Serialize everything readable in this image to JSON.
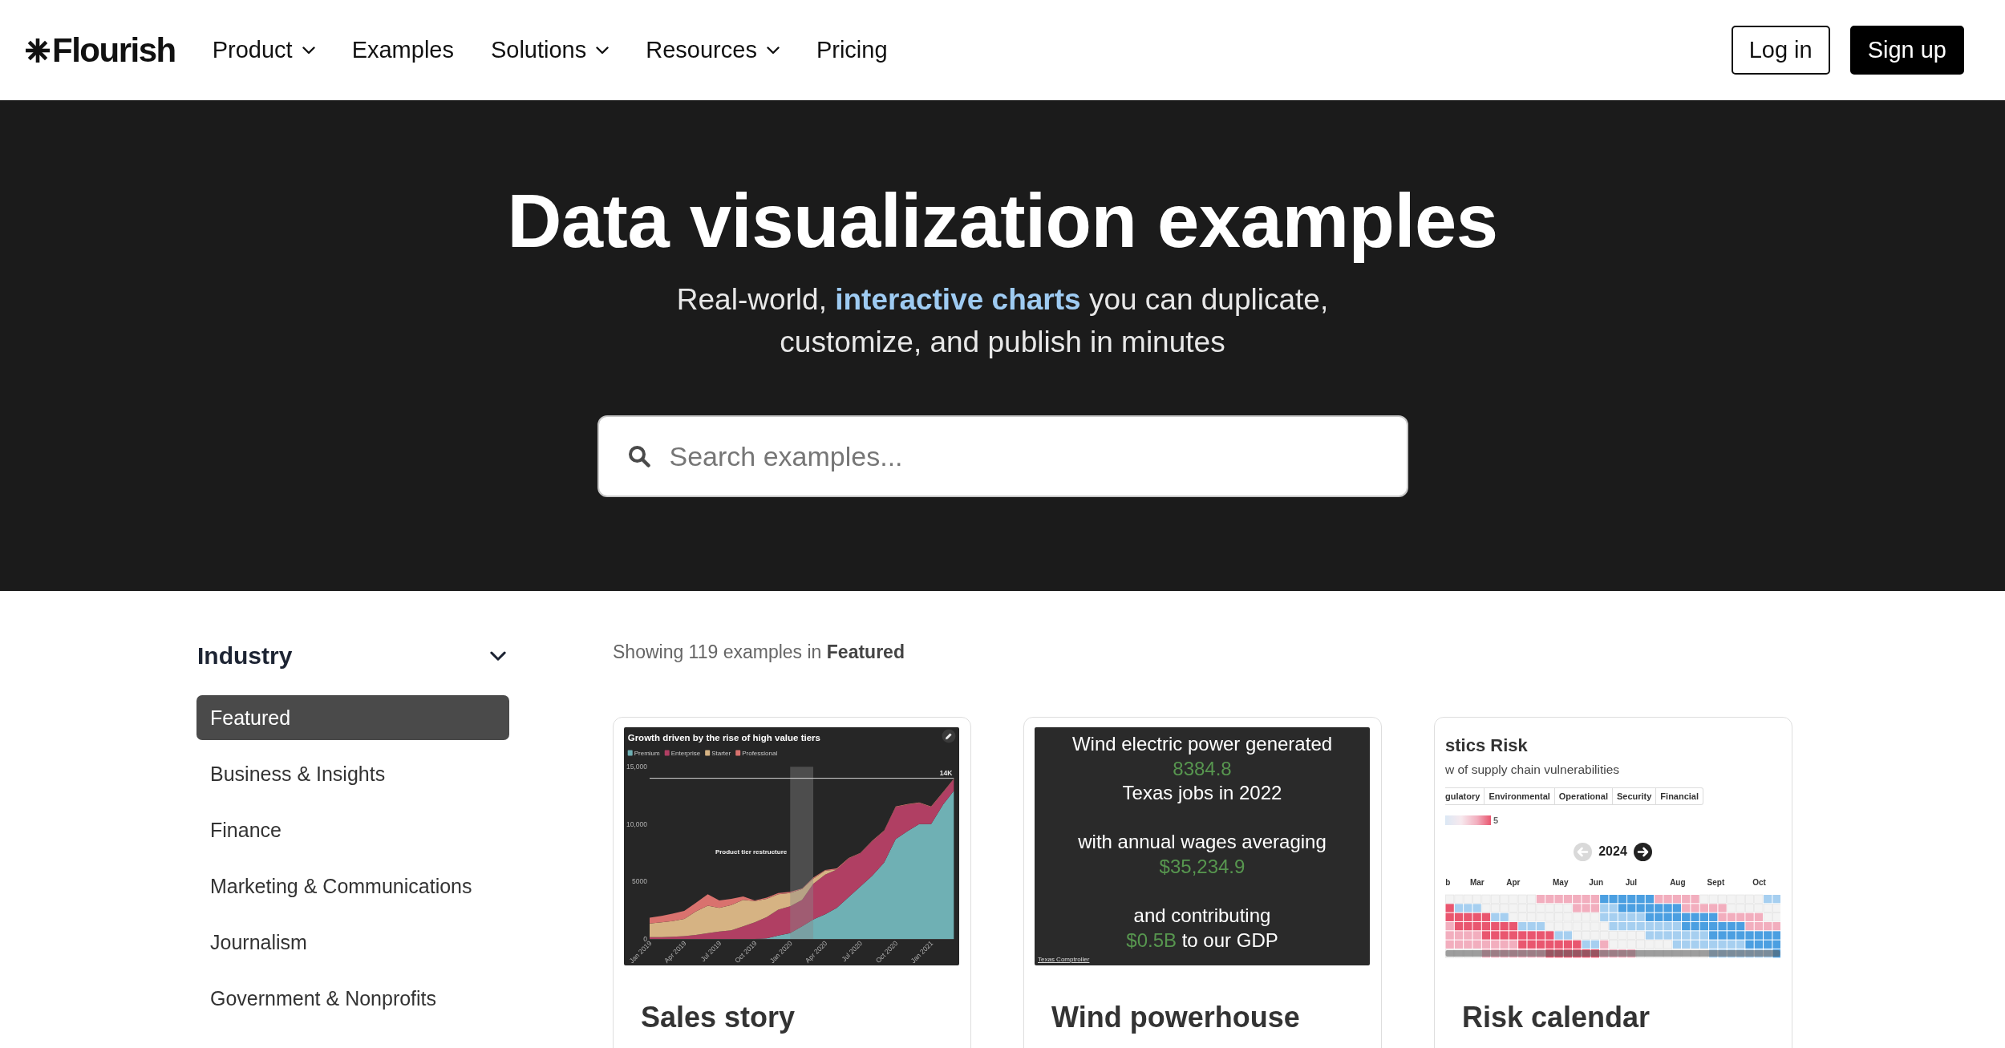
{
  "nav": {
    "logo": {
      "text": "Flourish"
    },
    "items": [
      {
        "label": "Product",
        "has_menu": true
      },
      {
        "label": "Examples",
        "has_menu": false
      },
      {
        "label": "Solutions",
        "has_menu": true
      },
      {
        "label": "Resources",
        "has_menu": true
      },
      {
        "label": "Pricing",
        "has_menu": false
      }
    ],
    "buttons": [
      {
        "label": "Log in",
        "kind": "outline"
      },
      {
        "label": "Sign up",
        "kind": "solid"
      }
    ]
  },
  "hero": {
    "title": "Data visualization examples",
    "subtitle": {
      "before": "Real-world,",
      "link": "interactive charts",
      "after": "you can duplicate, customize, and publish in minutes"
    },
    "search": {
      "placeholder": "Search examples..."
    }
  },
  "sidebar": {
    "groups": [
      {
        "title": "Industry",
        "expanded": true,
        "items": [
          {
            "label": "Featured",
            "selected": true
          },
          {
            "label": "Business & Insights",
            "selected": false
          },
          {
            "label": "Finance",
            "selected": false
          },
          {
            "label": "Marketing & Communications",
            "selected": false
          },
          {
            "label": "Journalism",
            "selected": false
          },
          {
            "label": "Government & Nonprofits",
            "selected": false
          }
        ]
      }
    ]
  },
  "results": {
    "summary": "Showing 119 examples in **Featured**",
    "cards": [
      {
        "kind": "chart",
        "title": "Sales story",
        "preview": {
          "chart_data": {
            "type": "area",
            "title": "Growth driven by the rise of high value tiers",
            "stacked": true,
            "legend": "top",
            "x": [
              "2019-01-01",
              "2019-02-01",
              "2019-03-01",
              "2019-04-01",
              "2019-05-01",
              "2019-06-01",
              "2019-07-01",
              "2019-08-01",
              "2019-09-01",
              "2019-10-01",
              "2019-11-01",
              "2019-12-01",
              "2020-01-01",
              "2020-02-01",
              "2020-03-01",
              "2020-04-01",
              "2020-05-01",
              "2020-06-01",
              "2020-07-01",
              "2020-08-01",
              "2020-09-01",
              "2020-10-01",
              "2020-11-01",
              "2020-12-01",
              "2021-01-01",
              "2021-02-01",
              "2021-03-01"
            ],
            "xlim": [
              "2019-01-01",
              "2021-03-01"
            ],
            "xticks": [
              {
                "value": "2019-01-01",
                "label": "Jan 2019"
              },
              {
                "value": "2019-04-01",
                "label": "Apr 2019"
              },
              {
                "value": "2019-07-01",
                "label": "Jul 2019"
              },
              {
                "value": "2019-10-01",
                "label": "Oct 2019"
              },
              {
                "value": "2020-01-01",
                "label": "Jan 2020"
              },
              {
                "value": "2020-04-01",
                "label": "Apr 2020"
              },
              {
                "value": "2020-07-01",
                "label": "Jul 2020"
              },
              {
                "value": "2020-10-01",
                "label": "Oct 2020"
              },
              {
                "value": "2021-01-01",
                "label": "Jan 2021"
              }
            ],
            "ylim": [
              0,
              15000
            ],
            "yticks": [
              {
                "value": 0,
                "label": "0"
              },
              {
                "value": 5000,
                "label": "5000"
              },
              {
                "value": 10000,
                "label": "10,000"
              },
              {
                "value": 15000,
                "label": "15,000"
              }
            ],
            "series": [
              {
                "name": "Premium",
                "color": "#6fb0b4",
                "values": [
                  0,
                  0,
                  0,
                  0,
                  0,
                  0,
                  0,
                  0,
                  0,
                  0,
                  50,
                  300,
                  500,
                  1100,
                  1700,
                  2150,
                  2700,
                  3650,
                  4550,
                  5500,
                  6650,
                  8700,
                  9400,
                  10000,
                  10000,
                  11700,
                  12900
                ]
              },
              {
                "name": "Enterprise",
                "color": "#b03f63",
                "values": [
                  150,
                  150,
                  200,
                  250,
                  350,
                  500,
                  650,
                  750,
                  1100,
                  1450,
                  1850,
                  2250,
                  2350,
                  2300,
                  3100,
                  3450,
                  3350,
                  3350,
                  2900,
                  3000,
                  2750,
                  2800,
                  2300,
                  1850,
                  1500,
                  1050,
                  1000
                ]
              },
              {
                "name": "Starter",
                "color": "#d6b383",
                "values": [
                  1200,
                  1300,
                  1350,
                  1500,
                  2050,
                  2400,
                  2050,
                  2200,
                  2300,
                  1850,
                  1600,
                  1350,
                  1150,
                  950,
                  450,
                  350,
                  0,
                  0,
                  0,
                  0,
                  0,
                  0,
                  0,
                  0,
                  0,
                  0,
                  0
                ]
              },
              {
                "name": "Professional",
                "color": "#d9726e",
                "values": [
                  500,
                  550,
                  650,
                  700,
                  750,
                  1000,
                  650,
                  550,
                  300,
                  50,
                  100,
                  100,
                  100,
                  50,
                  100,
                  50,
                  100,
                  50,
                  50,
                  50,
                  50,
                  50,
                  50,
                  50,
                  50,
                  50,
                  50
                ]
              }
            ],
            "ref_lines": [
              {
                "axis": "y",
                "value": 14000,
                "label": "14K",
                "color": "#d8d8d8"
              }
            ],
            "bands": [
              {
                "axis": "x",
                "from": "2020-01-01",
                "to": "2020-03-01",
                "label": "Product tier restructure",
                "color": "#8a8a8a"
              }
            ]
          }
        }
      },
      {
        "kind": "stats",
        "title": "Wind powerhouse",
        "preview": {
          "blocks": [
            {
              "lines": [
                [
                  {
                    "kind": "plain",
                    "text": "Wind electric power generated"
                  }
                ],
                [
                  {
                    "kind": "figure",
                    "text": "8384.8"
                  }
                ],
                [
                  {
                    "kind": "plain",
                    "text": "Texas jobs in 2022"
                  }
                ]
              ]
            },
            {
              "lines": [
                [
                  {
                    "kind": "plain",
                    "text": "with annual wages averaging"
                  }
                ],
                [
                  {
                    "kind": "figure",
                    "text": "$35,234.9"
                  }
                ]
              ]
            },
            {
              "lines": [
                [
                  {
                    "kind": "plain",
                    "text": "and contributing"
                  }
                ],
                [
                  {
                    "kind": "figure",
                    "text": "$0.5B"
                  },
                  {
                    "kind": "plain",
                    "text": "to our GDP"
                  }
                ]
              ]
            }
          ],
          "source": "Texas Comptroller"
        }
      },
      {
        "kind": "calendar",
        "title": "Risk calendar",
        "preview": {
          "heading": "stics Risk",
          "subheading": "w of supply chain vulnerabilities",
          "filters": [
            {
              "label": "gulatory"
            },
            {
              "label": "Environmental"
            },
            {
              "label": "Operational"
            },
            {
              "label": "Security"
            },
            {
              "label": "Financial"
            }
          ],
          "scale_max": "5",
          "year_nav": {
            "year": "2024",
            "prev": {
              "disabled": true
            },
            "next": {
              "disabled": false
            }
          },
          "months": [
            "b",
            "Mar",
            "Apr",
            "May",
            "Jun",
            "Jul",
            "Aug",
            "Sept",
            "Oct"
          ]
        }
      }
    ]
  }
}
